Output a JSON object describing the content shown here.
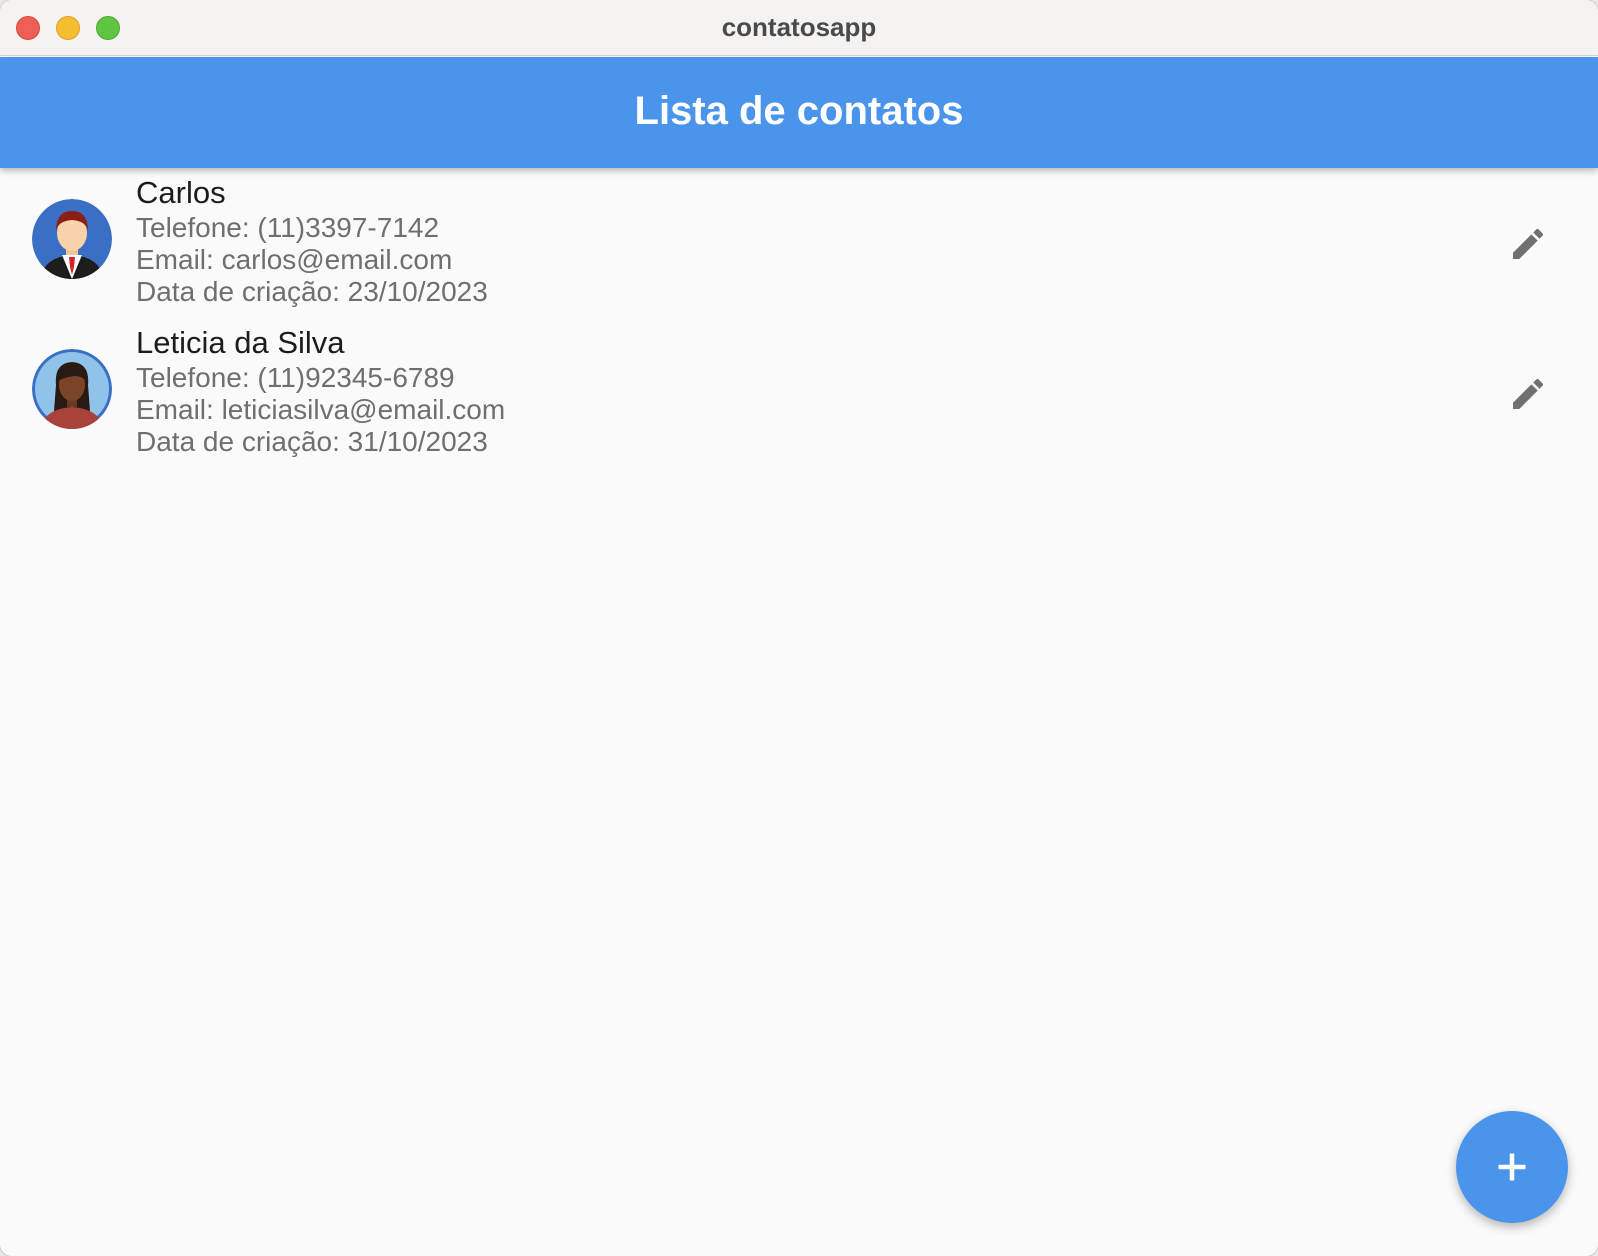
{
  "window": {
    "title": "contatosapp"
  },
  "appbar": {
    "title": "Lista de contatos"
  },
  "contacts": [
    {
      "name": "Carlos",
      "phone": "Telefone: (11)3397-7142",
      "email": "Email: carlos@email.com",
      "created": "Data de criação: 23/10/2023",
      "avatar": "man-avatar-icon"
    },
    {
      "name": "Leticia da Silva",
      "phone": "Telefone: (11)92345-6789",
      "email": "Email: leticiasilva@email.com",
      "created": "Data de criação: 31/10/2023",
      "avatar": "woman-avatar-icon"
    }
  ],
  "icons": {
    "edit": "pencil-icon",
    "add": "plus-icon"
  },
  "colors": {
    "primary": "#4a95eb",
    "background": "#fafafa",
    "icon": "#6f6f6f"
  }
}
